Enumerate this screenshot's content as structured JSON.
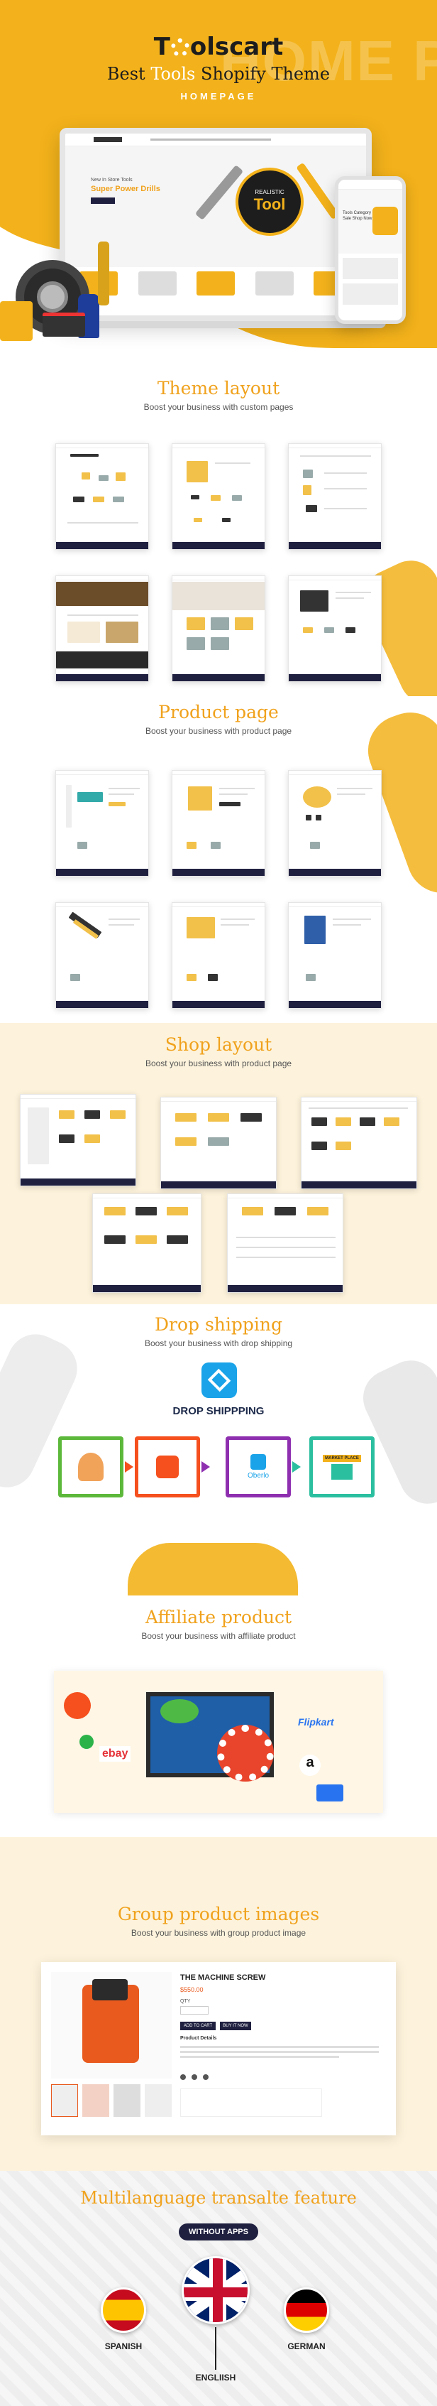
{
  "hero": {
    "logo_prefix": "T",
    "logo_rest": "olscart",
    "title_a": "Best ",
    "title_b": "Tools",
    "title_c": " Shopify Theme",
    "subtitle": "HOMEPAGE",
    "bg_word": "HOME PAGE",
    "mock_banner_small": "New In Store Tools",
    "mock_banner_title": "Super Power Drills",
    "badge_line1": "REALISTIC",
    "badge_line2": "Tool",
    "phone_banner": "Tools Category Sale Shop Now"
  },
  "theme_layout": {
    "title": "Theme layout",
    "subtitle": "Boost your business with custom pages"
  },
  "product_page": {
    "title": "Product page",
    "subtitle": "Boost your business with product page"
  },
  "shop_layout": {
    "title": "Shop layout",
    "subtitle": "Boost your business with product page"
  },
  "drop_shipping": {
    "title": "Drop shipping",
    "subtitle": "Boost your business with drop shipping",
    "label": "DROP SHIPPPING",
    "oberlo": "Oberlo",
    "market_label": "MARKET PLACE"
  },
  "affiliate": {
    "title": "Affiliate product",
    "subtitle": "Boost your business with affiliate product",
    "brand_flipkart": "Flipkart",
    "brand_ebay": "ebay",
    "brand_amazon": "a"
  },
  "group_images": {
    "title": "Group product images",
    "subtitle": "Boost your business with group product image",
    "product_title": "THE MACHINE SCREW",
    "price": "$550.00",
    "qty_label": "QTY",
    "add_btn": "ADD TO CART",
    "buy_btn": "BUY IT NOW",
    "details_label": "Product Details"
  },
  "multilang": {
    "title": "Multilanguage transalte feature",
    "pill": "WITHOUT APPS",
    "langs": [
      "SPANISH",
      "ENGLIISH",
      "GERMAN"
    ]
  },
  "colors": {
    "accent": "#f0a21d",
    "navy": "#1f2040",
    "cream": "#fdf3dc"
  }
}
